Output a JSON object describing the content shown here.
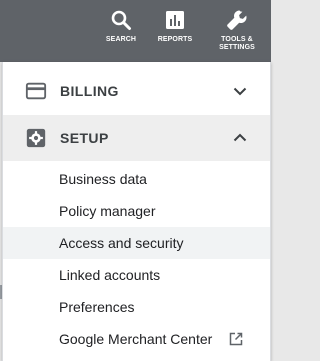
{
  "toolbar": {
    "search": {
      "label": "SEARCH",
      "icon": "search-icon"
    },
    "reports": {
      "label": "REPORTS",
      "icon": "bar-chart-icon"
    },
    "tools": {
      "label_line1": "TOOLS &",
      "label_line2": "SETTINGS",
      "icon": "wrench-icon"
    }
  },
  "menu": {
    "billing": {
      "label": "BILLING",
      "icon": "credit-card-icon",
      "expanded": false
    },
    "setup": {
      "label": "SETUP",
      "icon": "gear-icon",
      "expanded": true,
      "items": [
        {
          "label": "Business data"
        },
        {
          "label": "Policy manager"
        },
        {
          "label": "Access and security",
          "hovered": true
        },
        {
          "label": "Linked accounts"
        },
        {
          "label": "Preferences"
        },
        {
          "label": "Google Merchant Center",
          "external": true
        }
      ]
    }
  },
  "colors": {
    "topbar": "#5f6368",
    "panel": "#ffffff",
    "setup_highlight": "#eeeeee",
    "hover_row": "#f1f3f4",
    "text": "#202124",
    "icon": "#5f6368"
  }
}
